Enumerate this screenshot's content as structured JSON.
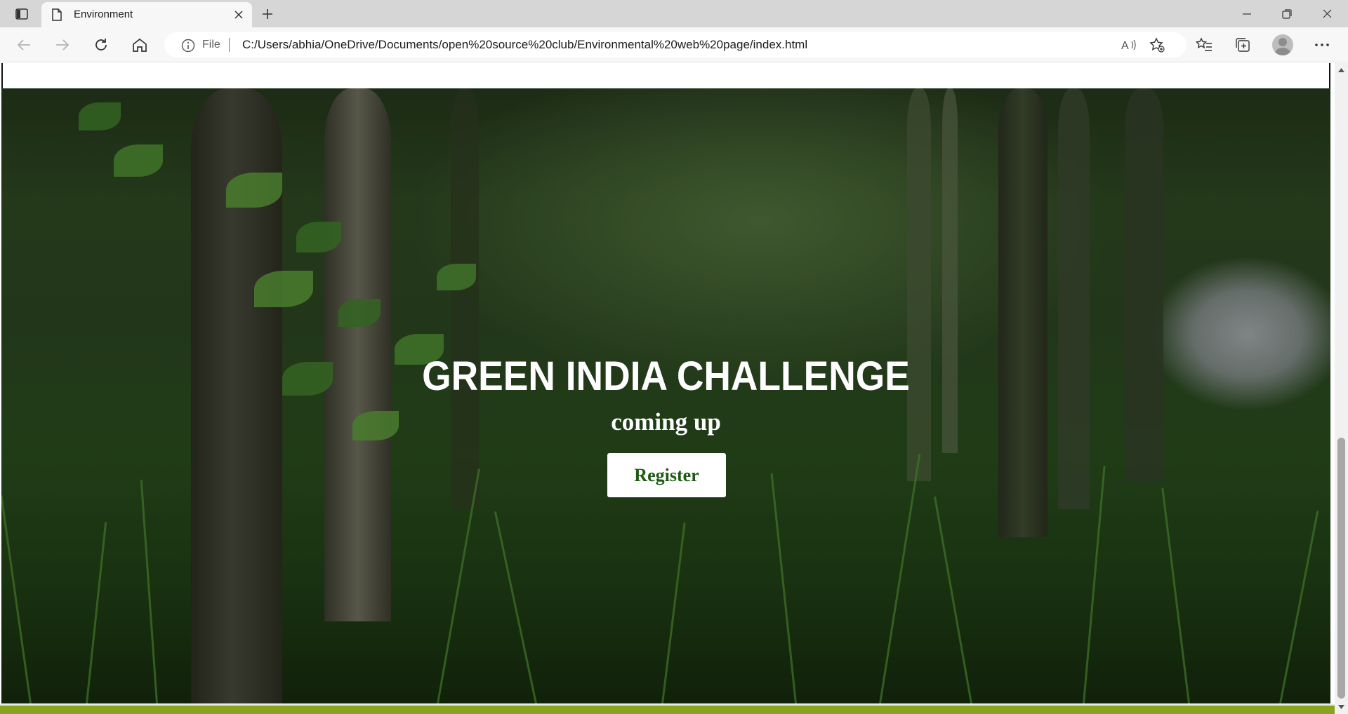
{
  "browser": {
    "tab_title": "Environment",
    "address_scheme_label": "File",
    "url": "C:/Users/abhia/OneDrive/Documents/open%20source%20club/Environmental%20web%20page/index.html"
  },
  "hero": {
    "title": "GREEN INDIA CHALLENGE",
    "subtitle": "coming up",
    "register_label": "Register"
  },
  "colors": {
    "accent_green": "#1f5a12",
    "footer_green": "#8aa31f"
  },
  "scroll": {
    "position_fraction": 0.58
  }
}
